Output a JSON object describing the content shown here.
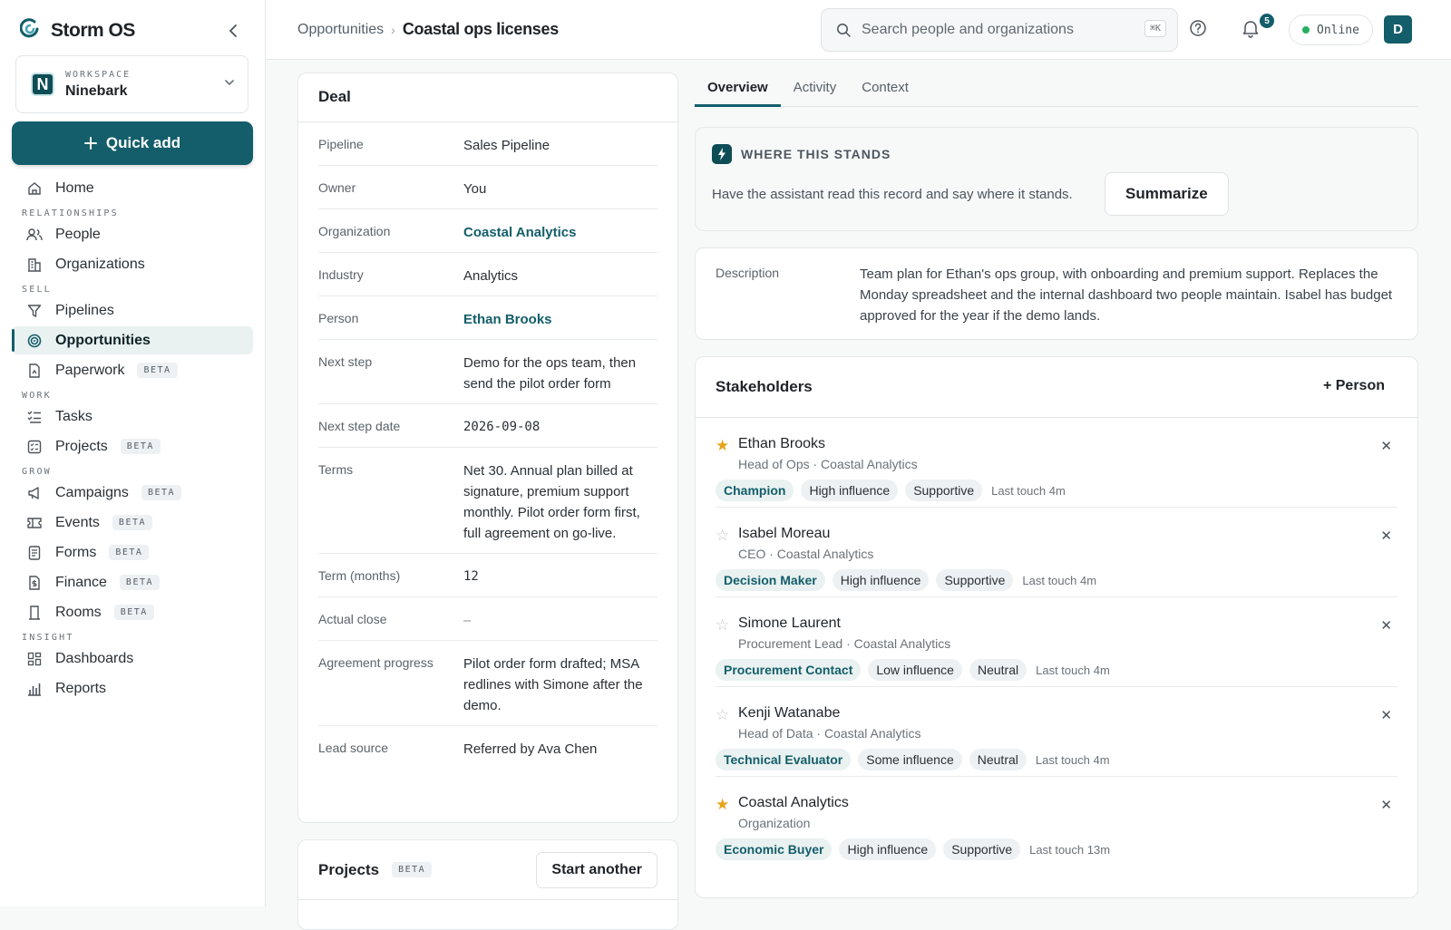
{
  "app": {
    "name": "Storm OS"
  },
  "workspace": {
    "label": "WORKSPACE",
    "name": "Ninebark",
    "logo_letter": "N"
  },
  "quick_add": {
    "label": "Quick add"
  },
  "nav": {
    "home": "Home",
    "sections": {
      "relationships": "RELATIONSHIPS",
      "sell": "SELL",
      "work": "WORK",
      "grow": "GROW",
      "insight": "INSIGHT"
    },
    "people": "People",
    "organizations": "Organizations",
    "pipelines": "Pipelines",
    "opportunities": "Opportunities",
    "paperwork": "Paperwork",
    "tasks": "Tasks",
    "projects": "Projects",
    "campaigns": "Campaigns",
    "events": "Events",
    "forms": "Forms",
    "finance": "Finance",
    "rooms": "Rooms",
    "dashboards": "Dashboards",
    "reports": "Reports",
    "beta": "BETA"
  },
  "header": {
    "breadcrumb_parent": "Opportunities",
    "breadcrumb_current": "Coastal ops licenses",
    "search_placeholder": "Search people and organizations",
    "search_shortcut": "⌘K",
    "notifications_count": "5",
    "status": "Online",
    "avatar_letter": "D"
  },
  "deal": {
    "title": "Deal",
    "rows": [
      {
        "k": "Pipeline",
        "v": "Sales Pipeline"
      },
      {
        "k": "Owner",
        "v": "You"
      },
      {
        "k": "Organization",
        "v": "Coastal Analytics"
      },
      {
        "k": "Industry",
        "v": "Analytics"
      },
      {
        "k": "Person",
        "v": "Ethan Brooks"
      },
      {
        "k": "Next step",
        "v": "Demo for the ops team, then send the pilot order form"
      },
      {
        "k": "Next step date",
        "v": "2026-09-08"
      },
      {
        "k": "Terms",
        "v": "Net 30. Annual plan billed at signature, premium support monthly. Pilot order form first, full agreement on go-live."
      },
      {
        "k": "Term (months)",
        "v": "12"
      },
      {
        "k": "Actual close",
        "v": "–"
      },
      {
        "k": "Agreement progress",
        "v": "Pilot order form drafted; MSA redlines with Simone after the demo."
      },
      {
        "k": "Lead source",
        "v": "Referred by Ava Chen"
      }
    ]
  },
  "projects": {
    "title": "Projects",
    "badge": "BETA",
    "start_label": "Start another"
  },
  "tabs": [
    "Overview",
    "Activity",
    "Context"
  ],
  "where": {
    "title": "WHERE THIS STANDS",
    "text": "Have the assistant read this record and say where it stands.",
    "button": "Summarize"
  },
  "description": {
    "label": "Description",
    "text": "Team plan for Ethan's ops group, with onboarding and premium support. Replaces the Monday spreadsheet and the internal dashboard two people maintain. Isabel has budget approved for the year if the demo lands."
  },
  "stakeholders": {
    "title": "Stakeholders",
    "add_label": "+ Person",
    "people": [
      {
        "name": "Ethan Brooks",
        "role": "Head of Ops · Coastal Analytics",
        "starred": "★",
        "tag": "Champion",
        "influence": "High influence",
        "sentiment": "Supportive",
        "touch": "Last touch 4m"
      },
      {
        "name": "Isabel Moreau",
        "role": "CEO · Coastal Analytics",
        "starred": "☆",
        "tag": "Decision Maker",
        "influence": "High influence",
        "sentiment": "Supportive",
        "touch": "Last touch 4m"
      },
      {
        "name": "Simone Laurent",
        "role": "Procurement Lead · Coastal Analytics",
        "starred": "☆",
        "tag": "Procurement Contact",
        "influence": "Low influence",
        "sentiment": "Neutral",
        "touch": "Last touch 4m"
      },
      {
        "name": "Kenji Watanabe",
        "role": "Head of Data · Coastal Analytics",
        "starred": "☆",
        "tag": "Technical Evaluator",
        "influence": "Some influence",
        "sentiment": "Neutral",
        "touch": "Last touch 4m"
      },
      {
        "name": "Coastal Analytics",
        "role": "Organization",
        "starred": "★",
        "tag": "Economic Buyer",
        "influence": "High influence",
        "sentiment": "Supportive",
        "touch": "Last touch 13m"
      }
    ]
  },
  "colors": {
    "brand": "#135e6a",
    "star": "#e8a317",
    "online": "#27ae60"
  }
}
